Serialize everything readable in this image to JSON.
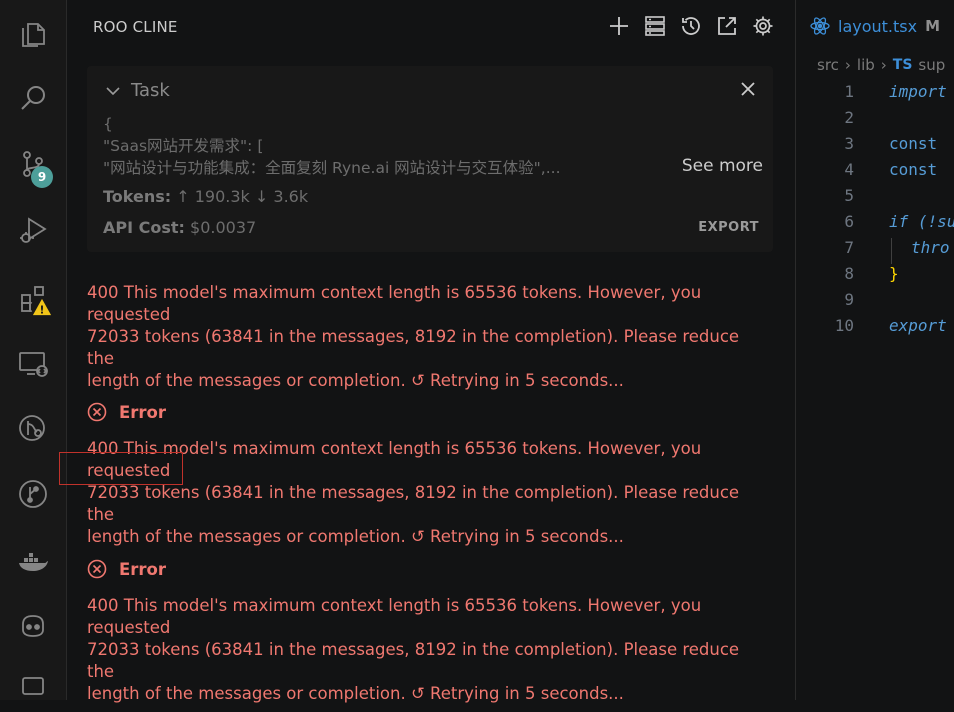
{
  "sidebar": {
    "title": "ROO CLINE",
    "source_control_badge": "9",
    "extensions_badge": "!"
  },
  "task": {
    "label": "Task",
    "lines": [
      "{",
      "\"Saas网站开发需求\": [",
      "\"网站设计与功能集成：全面复刻 Ryne.ai 网站设计与交互体验\",..."
    ],
    "see_more": "See more",
    "tokens_label": "Tokens:",
    "tokens_up": "↑ 190.3k",
    "tokens_down": "↓ 3.6k",
    "cost_label": "API Cost:",
    "cost_value": "$0.0037",
    "export_label": "EXPORT"
  },
  "messages": [
    {
      "title": "",
      "lines": [
        "400 This model's maximum context length is 65536 tokens. However, you requested",
        "72033 tokens (63841 in the messages, 8192 in the completion). Please reduce the",
        "length of the messages or completion. ↺ Retrying in 5 seconds..."
      ]
    },
    {
      "title": "Error",
      "lines": [
        "400 This model's maximum context length is 65536 tokens. However, you requested",
        "72033 tokens (63841 in the messages, 8192 in the completion). Please reduce the",
        "length of the messages or completion. ↺ Retrying in 5 seconds..."
      ]
    },
    {
      "title": "Error",
      "lines": [
        "400 This model's maximum context length is 65536 tokens. However, you requested",
        "72033 tokens (63841 in the messages, 8192 in the completion). Please reduce the",
        "length of the messages or completion. ↺ Retrying in 5 seconds..."
      ]
    }
  ],
  "editor": {
    "tab_name": "layout.tsx",
    "tab_status": "M",
    "breadcrumb": [
      "src",
      "lib",
      "TS",
      "sup"
    ],
    "lines": [
      {
        "n": "1",
        "text": "import"
      },
      {
        "n": "2",
        "text": ""
      },
      {
        "n": "3",
        "text": "const"
      },
      {
        "n": "4",
        "text": "const"
      },
      {
        "n": "5",
        "text": ""
      },
      {
        "n": "6",
        "text": "if (!su"
      },
      {
        "n": "7",
        "text": "thro"
      },
      {
        "n": "8",
        "text": "}"
      },
      {
        "n": "9",
        "text": ""
      },
      {
        "n": "10",
        "text": "export"
      }
    ]
  },
  "colors": {
    "error": "#f07870",
    "accent": "#3d8fd9",
    "badge": "#4d9f9a",
    "warning": "#f0c419"
  }
}
